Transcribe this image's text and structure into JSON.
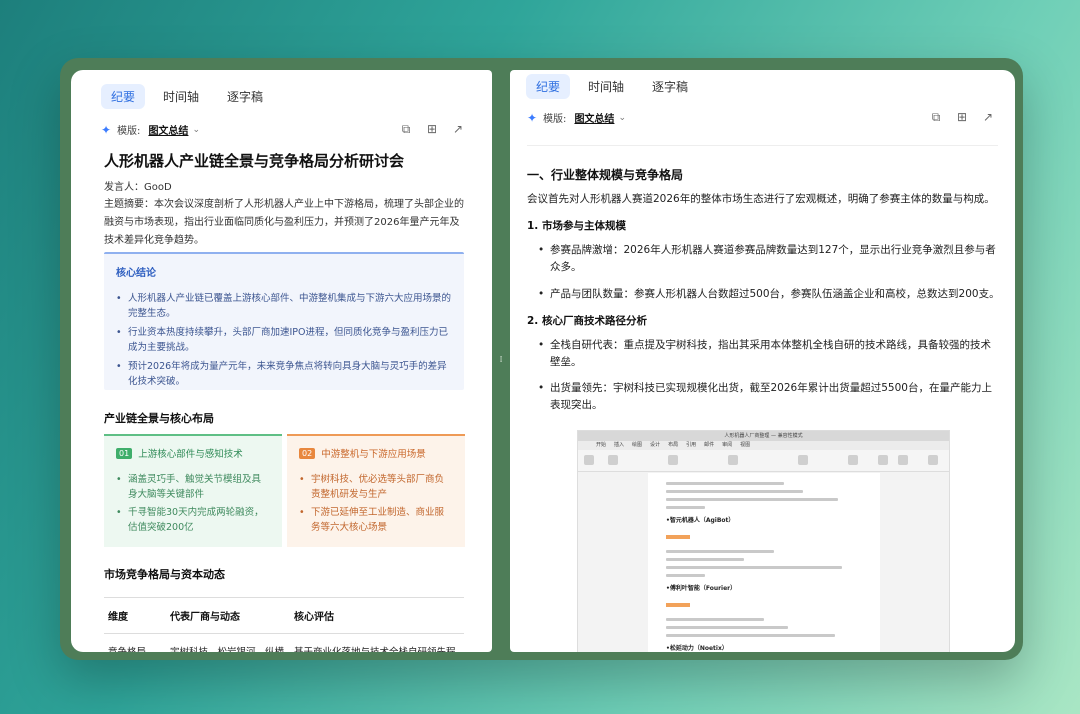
{
  "left": {
    "tabs": [
      "纪要",
      "时间轴",
      "逐字稿"
    ],
    "template_label": "模版:",
    "template_value": "图文总结",
    "title": "人形机器人产业链全景与竞争格局分析研讨会",
    "speaker": "发言人：GooD",
    "summary": "主题摘要：本次会议深度剖析了人形机器人产业上中下游格局，梳理了头部企业的融资与市场表现，指出行业面临同质化与盈利压力，并预测了2026年量产元年及技术差异化竞争趋势。",
    "conclusion": {
      "title": "核心结论",
      "items": [
        "人形机器人产业链已覆盖上游核心部件、中游整机集成与下游六大应用场景的完整生态。",
        "行业资本热度持续攀升，头部厂商加速IPO进程，但同质化竞争与盈利压力已成为主要挑战。",
        "预计2026年将成为量产元年，未来竞争焦点将转向具身大脑与灵巧手的差异化技术突破。"
      ]
    },
    "section1": "产业链全景与核心布局",
    "card_green": {
      "badge": "01",
      "title": "上游核心部件与感知技术",
      "items": [
        "涵盖灵巧手、触觉关节模组及具身大脑等关键部件",
        "千寻智能30天内完成两轮融资，估值突破200亿"
      ]
    },
    "card_orange": {
      "badge": "02",
      "title": "中游整机与下游应用场景",
      "items": [
        "宇树科技、优必选等头部厂商负责整机研发与生产",
        "下游已延伸至工业制造、商业服务等六大核心场景"
      ]
    },
    "section2": "市场竞争格局与资本动态",
    "table": {
      "headers": [
        "维度",
        "代表厂商与动态",
        "核心评估"
      ],
      "row": [
        "竞争格局",
        "宇树科技、松岩银河、纵横天宇等",
        "基于商业化落地与技术全栈自研领先程度处于头部，持续占据份额"
      ]
    }
  },
  "right": {
    "tabs": [
      "纪要",
      "时间轴",
      "逐字稿"
    ],
    "template_label": "模版:",
    "template_value": "图文总结",
    "h1": "一、行业整体规模与竞争格局",
    "intro": "会议首先对人形机器人赛道2026年的整体市场生态进行了宏观概述，明确了参赛主体的数量与构成。",
    "sub1": "1. 市场参与主体规模",
    "sub1_items": [
      "参赛品牌激增：2026年人形机器人赛道参赛品牌数量达到127个，显示出行业竞争激烈且参与者众多。",
      "产品与团队数量：参赛人形机器人台数超过500台，参赛队伍涵盖企业和高校，总数达到200支。"
    ],
    "sub2": "2. 核心厂商技术路径分析",
    "sub2_items": [
      "全栈自研代表：重点提及宇树科技，指出其采用本体整机全栈自研的技术路线，具备较强的技术壁垒。",
      "出货量领先：宇树科技已实现规模化出货，截至2026年累计出货量超过5500台，在量产能力上表现突出。"
    ],
    "doc": {
      "titlebar": "人形机器人厂商整理 — 兼容性模式",
      "menu": [
        "开始",
        "插入",
        "绘图",
        "设计",
        "布局",
        "引用",
        "邮件",
        "审阅",
        "视图"
      ],
      "heads": [
        "•智元机器人（AgiBot）",
        "•傅利叶智能（Fourier）",
        "•松延动力（Noetix）"
      ]
    }
  }
}
